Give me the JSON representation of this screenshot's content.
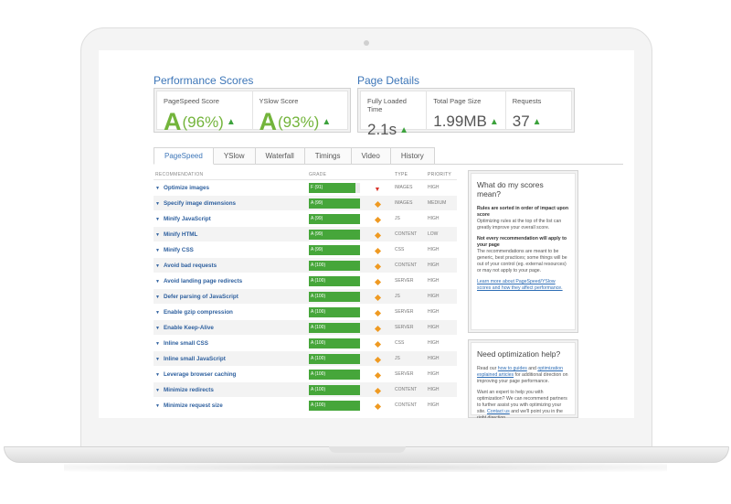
{
  "performance": {
    "title": "Performance Scores",
    "pagespeed": {
      "label": "PageSpeed Score",
      "grade": "A",
      "pct": "(96%)"
    },
    "yslow": {
      "label": "YSlow Score",
      "grade": "A",
      "pct": "(93%)"
    }
  },
  "details": {
    "title": "Page Details",
    "load": {
      "label": "Fully Loaded Time",
      "value": "2.1s"
    },
    "size": {
      "label": "Total Page Size",
      "value": "1.99MB"
    },
    "requests": {
      "label": "Requests",
      "value": "37"
    }
  },
  "tabs": [
    "PageSpeed",
    "YSlow",
    "Waterfall",
    "Timings",
    "Video",
    "History"
  ],
  "table": {
    "headers": {
      "recommendation": "RECOMMENDATION",
      "grade": "GRADE",
      "type": "TYPE",
      "priority": "PRIORITY"
    },
    "rows": [
      {
        "name": "Optimize images",
        "grade": "F (91)",
        "fill": 0.91,
        "trend": "down",
        "type": "IMAGES",
        "priority": "HIGH"
      },
      {
        "name": "Specify image dimensions",
        "grade": "A (99)",
        "fill": 1,
        "trend": "neutral",
        "type": "IMAGES",
        "priority": "MEDIUM"
      },
      {
        "name": "Minify JavaScript",
        "grade": "A (99)",
        "fill": 1,
        "trend": "neutral",
        "type": "JS",
        "priority": "HIGH"
      },
      {
        "name": "Minify HTML",
        "grade": "A (99)",
        "fill": 1,
        "trend": "neutral",
        "type": "CONTENT",
        "priority": "LOW"
      },
      {
        "name": "Minify CSS",
        "grade": "A (99)",
        "fill": 1,
        "trend": "neutral",
        "type": "CSS",
        "priority": "HIGH"
      },
      {
        "name": "Avoid bad requests",
        "grade": "A (100)",
        "fill": 1,
        "trend": "neutral",
        "type": "CONTENT",
        "priority": "HIGH"
      },
      {
        "name": "Avoid landing page redirects",
        "grade": "A (100)",
        "fill": 1,
        "trend": "neutral",
        "type": "SERVER",
        "priority": "HIGH"
      },
      {
        "name": "Defer parsing of JavaScript",
        "grade": "A (100)",
        "fill": 1,
        "trend": "neutral",
        "type": "JS",
        "priority": "HIGH"
      },
      {
        "name": "Enable gzip compression",
        "grade": "A (100)",
        "fill": 1,
        "trend": "neutral",
        "type": "SERVER",
        "priority": "HIGH"
      },
      {
        "name": "Enable Keep-Alive",
        "grade": "A (100)",
        "fill": 1,
        "trend": "neutral",
        "type": "SERVER",
        "priority": "HIGH"
      },
      {
        "name": "Inline small CSS",
        "grade": "A (100)",
        "fill": 1,
        "trend": "neutral",
        "type": "CSS",
        "priority": "HIGH"
      },
      {
        "name": "Inline small JavaScript",
        "grade": "A (100)",
        "fill": 1,
        "trend": "neutral",
        "type": "JS",
        "priority": "HIGH"
      },
      {
        "name": "Leverage browser caching",
        "grade": "A (100)",
        "fill": 1,
        "trend": "neutral",
        "type": "SERVER",
        "priority": "HIGH"
      },
      {
        "name": "Minimize redirects",
        "grade": "A (100)",
        "fill": 1,
        "trend": "neutral",
        "type": "CONTENT",
        "priority": "HIGH"
      },
      {
        "name": "Minimize request size",
        "grade": "A (100)",
        "fill": 1,
        "trend": "neutral",
        "type": "CONTENT",
        "priority": "HIGH"
      }
    ]
  },
  "scores_panel": {
    "title": "What do my scores mean?",
    "h1": "Rules are sorted in order of impact upon score",
    "p1": "Optimizing rules at the top of the list can greatly improve your overall score.",
    "h2": "Not every recommendation will apply to your page",
    "p2": "The recommendations are meant to be generic, best practices; some things will be out of your control (eg. external resources) or may not apply to your page.",
    "link": "Learn more about PageSpeed/YSlow scores and how they affect performance."
  },
  "help_panel": {
    "title": "Need optimization help?",
    "p1_a": "Read our ",
    "p1_link1": "how to guides",
    "p1_b": " and ",
    "p1_link2": "optimization explained articles",
    "p1_c": " for additional direction on improving your page performance.",
    "p2_a": "Want an expert to help you with optimization? We can recommend partners to further assist you with optimizing your site. ",
    "p2_link": "Contact us",
    "p2_b": " and we'll point you in the right direction."
  },
  "colors": {
    "accent": "#3d76b8",
    "grade_green": "#73b43b",
    "bar_green": "#46a63a",
    "down_red": "#d9342b",
    "neutral_orange": "#ef9a22"
  }
}
